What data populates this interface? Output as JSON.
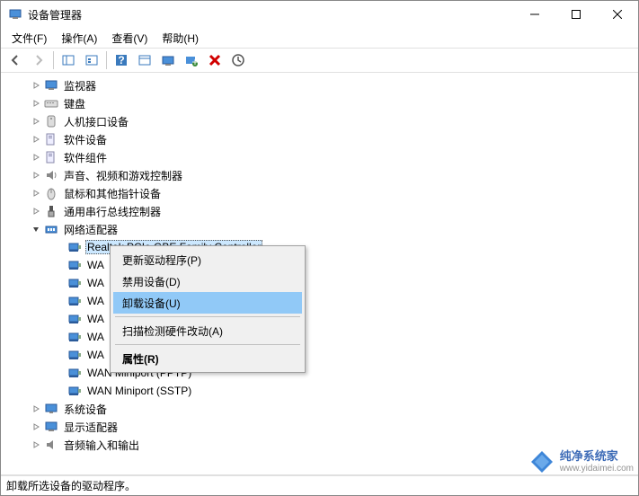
{
  "titlebar": {
    "title": "设备管理器"
  },
  "menubar": {
    "items": [
      {
        "label": "文件(F)"
      },
      {
        "label": "操作(A)"
      },
      {
        "label": "查看(V)"
      },
      {
        "label": "帮助(H)"
      }
    ]
  },
  "toolbar": {
    "back": "back-icon",
    "forward": "forward-icon",
    "show_hide": "pane-icon",
    "up": "up-icon",
    "help": "help-icon",
    "props": "props-icon",
    "monitor": "monitor-icon",
    "scan": "scan-icon",
    "remove": "remove-icon",
    "refresh": "refresh-icon"
  },
  "tree": [
    {
      "level": 2,
      "expand": "closed",
      "icon": "monitor",
      "label": "监视器"
    },
    {
      "level": 2,
      "expand": "closed",
      "icon": "keyboard",
      "label": "键盘"
    },
    {
      "level": 2,
      "expand": "closed",
      "icon": "hid",
      "label": "人机接口设备"
    },
    {
      "level": 2,
      "expand": "closed",
      "icon": "software",
      "label": "软件设备"
    },
    {
      "level": 2,
      "expand": "closed",
      "icon": "software",
      "label": "软件组件"
    },
    {
      "level": 2,
      "expand": "closed",
      "icon": "audio",
      "label": "声音、视频和游戏控制器"
    },
    {
      "level": 2,
      "expand": "closed",
      "icon": "mouse",
      "label": "鼠标和其他指针设备"
    },
    {
      "level": 2,
      "expand": "closed",
      "icon": "usb",
      "label": "通用串行总线控制器"
    },
    {
      "level": 2,
      "expand": "open",
      "icon": "network",
      "label": "网络适配器"
    },
    {
      "level": 3,
      "expand": "none",
      "icon": "nic",
      "label": "Realtek PCIe GBE Family Controller",
      "selected": true,
      "truncated": true
    },
    {
      "level": 3,
      "expand": "none",
      "icon": "nic",
      "label": "WA"
    },
    {
      "level": 3,
      "expand": "none",
      "icon": "nic",
      "label": "WA"
    },
    {
      "level": 3,
      "expand": "none",
      "icon": "nic",
      "label": "WA"
    },
    {
      "level": 3,
      "expand": "none",
      "icon": "nic",
      "label": "WA"
    },
    {
      "level": 3,
      "expand": "none",
      "icon": "nic",
      "label": "WA"
    },
    {
      "level": 3,
      "expand": "none",
      "icon": "nic",
      "label": "WA"
    },
    {
      "level": 3,
      "expand": "none",
      "icon": "nic",
      "label": "WAN Miniport (PPTP)"
    },
    {
      "level": 3,
      "expand": "none",
      "icon": "nic",
      "label": "WAN Miniport (SSTP)"
    },
    {
      "level": 2,
      "expand": "closed",
      "icon": "system",
      "label": "系统设备"
    },
    {
      "level": 2,
      "expand": "closed",
      "icon": "display",
      "label": "显示适配器"
    },
    {
      "level": 2,
      "expand": "closed",
      "icon": "audioio",
      "label": "音频输入和输出"
    }
  ],
  "context_menu": {
    "items": [
      {
        "label": "更新驱动程序(P)",
        "highlight": false
      },
      {
        "label": "禁用设备(D)",
        "highlight": false
      },
      {
        "label": "卸载设备(U)",
        "highlight": true
      },
      {
        "sep": true
      },
      {
        "label": "扫描检测硬件改动(A)",
        "highlight": false
      },
      {
        "sep": true
      },
      {
        "label": "属性(R)",
        "highlight": false,
        "bold": true
      }
    ]
  },
  "statusbar": {
    "text": "卸载所选设备的驱动程序。"
  },
  "watermark": {
    "line1": "纯净系统家",
    "line2": "www.yidaimei.com"
  }
}
